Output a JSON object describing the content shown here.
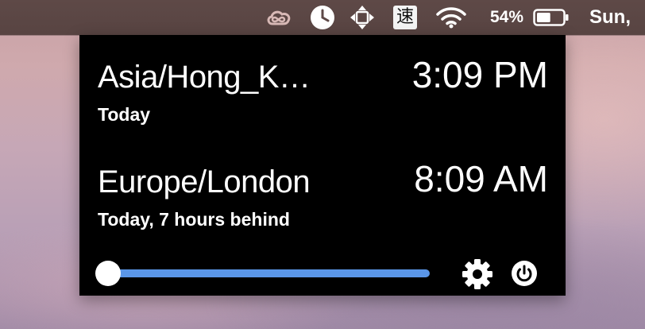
{
  "menubar": {
    "icons": {
      "creative_cloud": "creative-cloud-icon",
      "clock": "clock-icon",
      "move": "move-arrows-icon",
      "ime": "input-method-icon",
      "wifi": "wifi-icon",
      "battery": "battery-icon"
    },
    "ime_label": "速",
    "battery_percent": "54%",
    "battery_level": 0.54,
    "clock_text": "Sun,"
  },
  "popover": {
    "zones": [
      {
        "name": "Asia/Hong_K…",
        "time": "3:09 PM",
        "subtitle": "Today"
      },
      {
        "name": "Europe/London",
        "time": "8:09 AM",
        "subtitle": "Today, 7 hours behind"
      }
    ],
    "slider": {
      "value": 0,
      "track_color": "#5a96e8"
    },
    "icons": {
      "settings": "gear-icon",
      "quit": "power-icon"
    }
  },
  "colors": {
    "menubar_bg": "#5e4947",
    "panel_bg": "#000000",
    "text": "#ffffff",
    "accent": "#5a96e8"
  }
}
